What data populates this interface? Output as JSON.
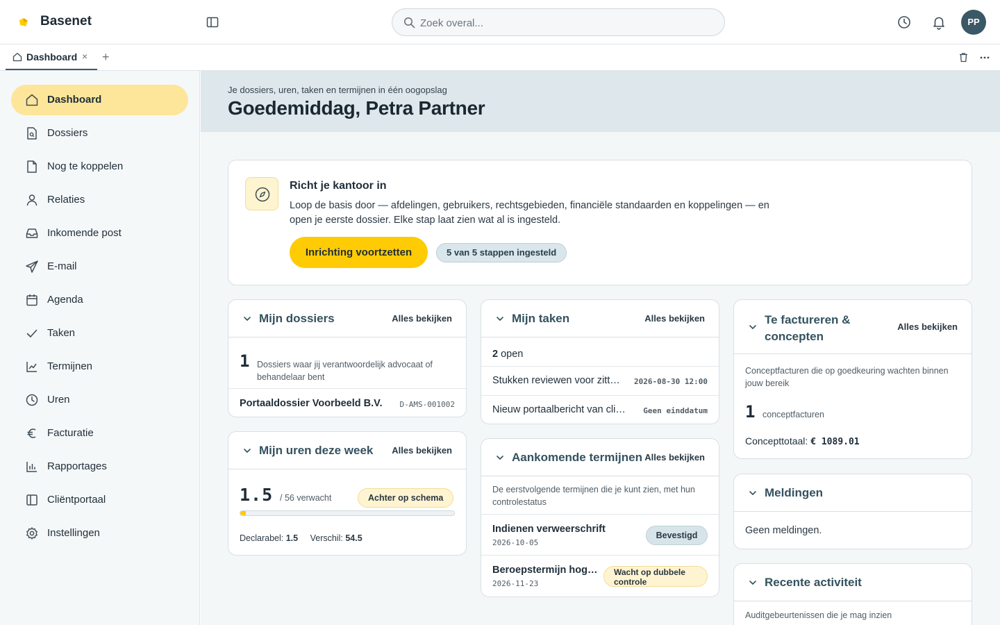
{
  "app": {
    "brand": "Basenet",
    "avatar_initials": "PP"
  },
  "search": {
    "placeholder": "Zoek overal..."
  },
  "tabs": {
    "active_label": "Dashboard",
    "close": "×",
    "add": "+"
  },
  "sidebar": {
    "items": [
      {
        "label": "Dashboard",
        "icon": "home-icon"
      },
      {
        "label": "Dossiers",
        "icon": "file-search-icon"
      },
      {
        "label": "Nog te koppelen",
        "icon": "file-icon"
      },
      {
        "label": "Relaties",
        "icon": "user-icon"
      },
      {
        "label": "Inkomende post",
        "icon": "inbox-icon"
      },
      {
        "label": "E-mail",
        "icon": "send-icon"
      },
      {
        "label": "Agenda",
        "icon": "calendar-icon"
      },
      {
        "label": "Taken",
        "icon": "check-icon"
      },
      {
        "label": "Termijnen",
        "icon": "chart-line-icon"
      },
      {
        "label": "Uren",
        "icon": "clock-icon"
      },
      {
        "label": "Facturatie",
        "icon": "euro-icon"
      },
      {
        "label": "Rapportages",
        "icon": "bar-chart-icon"
      },
      {
        "label": "Cliëntportaal",
        "icon": "panel-icon"
      },
      {
        "label": "Instellingen",
        "icon": "settings-icon"
      }
    ]
  },
  "hero": {
    "subtitle": "Je dossiers, uren, taken en termijnen in één oogopslag",
    "greeting": "Goedemiddag, Petra Partner"
  },
  "setup": {
    "title": "Richt je kantoor in",
    "description": "Loop de basis door — afdelingen, gebruikers, rechtsgebieden, financiële standaarden en koppelingen — en open je eerste dossier. Elke stap laat zien wat al is ingesteld.",
    "button": "Inrichting voortzetten",
    "status": "5 van 5 stappen ingesteld"
  },
  "common": {
    "view_all": "Alles bekijken"
  },
  "dossiers": {
    "title": "Mijn dossiers",
    "count": "1",
    "count_label": "Dossiers waar jij verantwoordelijk advocaat of behandelaar bent",
    "items": [
      {
        "name": "Portaaldossier Voorbeeld B.V.",
        "code": "D-AMS-001002"
      }
    ]
  },
  "hours": {
    "title": "Mijn uren deze week",
    "value": "1.5",
    "expected": "/ 56 verwacht",
    "status": "Achter op schema",
    "progress": 0.027,
    "billable_label": "Declarabel:",
    "billable_value": "1.5",
    "diff_label": "Verschil:",
    "diff_value": "54.5"
  },
  "tasks": {
    "title": "Mijn taken",
    "open_count": "2",
    "open_label": "open",
    "items": [
      {
        "name": "Stukken reviewen voor zitt…",
        "due": "2026-08-30 12:00"
      },
      {
        "name": "Nieuw portaalbericht van cli…",
        "due": "Geen einddatum"
      }
    ]
  },
  "deadlines": {
    "title": "Aankomende termijnen",
    "description": "De eerstvolgende termijnen die je kunt zien, met hun controlestatus",
    "items": [
      {
        "name": "Indienen verweerschrift",
        "date": "2026-10-05",
        "status": "Bevestigd"
      },
      {
        "name": "Beroepstermijn hog…",
        "date": "2026-11-23",
        "status": "Wacht op dubbele controle"
      }
    ]
  },
  "billing": {
    "title": "Te factureren & concepten",
    "description": "Conceptfacturen die op goedkeuring wachten binnen jouw bereik",
    "count": "1",
    "count_label": "conceptfacturen",
    "total_label": "Concepttotaal:",
    "total_value": "€ 1089.01"
  },
  "notifications": {
    "title": "Meldingen",
    "empty": "Geen meldingen."
  },
  "activity": {
    "title": "Recente activiteit",
    "description": "Auditgebeurtenissen die je mag inzien"
  },
  "colors": {
    "accent": "#ffcb05",
    "active_nav": "#fde69a",
    "heading": "#34525f",
    "avatar": "#3a5866"
  }
}
